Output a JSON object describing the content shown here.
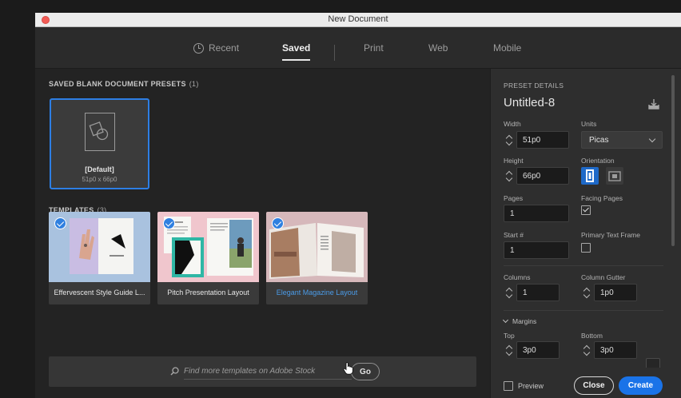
{
  "window": {
    "title": "New Document"
  },
  "tabs": [
    {
      "label": "Recent",
      "icon": "clock-icon",
      "active": false
    },
    {
      "label": "Saved",
      "active": true
    },
    {
      "label": "Print",
      "active": false
    },
    {
      "label": "Web",
      "active": false
    },
    {
      "label": "Mobile",
      "active": false
    }
  ],
  "presets": {
    "heading": "SAVED BLANK DOCUMENT PRESETS",
    "count": "(1)",
    "items": [
      {
        "name": "[Default]",
        "size": "51p0 x 66p0",
        "selected": true
      }
    ]
  },
  "templates": {
    "heading": "TEMPLATES",
    "count": "(3)",
    "items": [
      {
        "name": "Effervescent Style Guide L...",
        "checked": true
      },
      {
        "name": "Pitch Presentation Layout",
        "checked": true
      },
      {
        "name": "Elegant Magazine Layout",
        "checked": true,
        "hovered": true
      }
    ]
  },
  "search": {
    "placeholder": "Find more templates on Adobe Stock",
    "go_label": "Go"
  },
  "details": {
    "heading": "PRESET DETAILS",
    "doc_name": "Untitled-8",
    "width_label": "Width",
    "width_value": "51p0",
    "units_label": "Units",
    "units_value": "Picas",
    "height_label": "Height",
    "height_value": "66p0",
    "orientation_label": "Orientation",
    "orientation_value": "portrait",
    "pages_label": "Pages",
    "pages_value": "1",
    "facing_label": "Facing Pages",
    "facing_checked": true,
    "start_label": "Start #",
    "start_value": "1",
    "primary_label": "Primary Text Frame",
    "primary_checked": false,
    "columns_label": "Columns",
    "columns_value": "1",
    "gutter_label": "Column Gutter",
    "gutter_value": "1p0",
    "margins_label": "Margins",
    "top_label": "Top",
    "top_value": "3p0",
    "bottom_label": "Bottom",
    "bottom_value": "3p0",
    "preview_label": "Preview",
    "preview_checked": false
  },
  "buttons": {
    "close": "Close",
    "create": "Create"
  },
  "colors": {
    "accent": "#1a73e8",
    "selection_border": "#2d7ee4",
    "link_text": "#4b9be8"
  }
}
